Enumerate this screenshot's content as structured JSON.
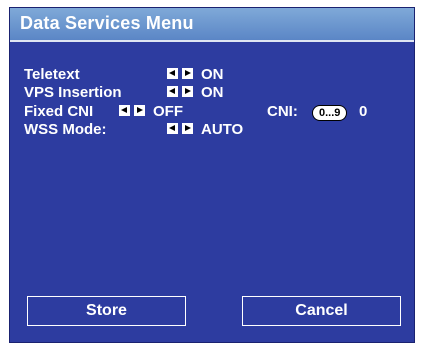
{
  "window": {
    "title": "Data Services Menu"
  },
  "settings": {
    "teletext": {
      "label": "Teletext",
      "value": "ON"
    },
    "vps_insertion": {
      "label": "VPS Insertion",
      "value": "ON"
    },
    "fixed_cni": {
      "label": "Fixed CNI",
      "value": "OFF",
      "cni_label": "CNI:",
      "cni_input": "0...9",
      "cni_value": "0"
    },
    "wss_mode": {
      "label": "WSS Mode:",
      "value": "AUTO"
    }
  },
  "buttons": {
    "store": "Store",
    "cancel": "Cancel"
  },
  "colors": {
    "background": "#2d3ca0",
    "title_bar": "#6b96cf",
    "text": "#ffffff"
  }
}
